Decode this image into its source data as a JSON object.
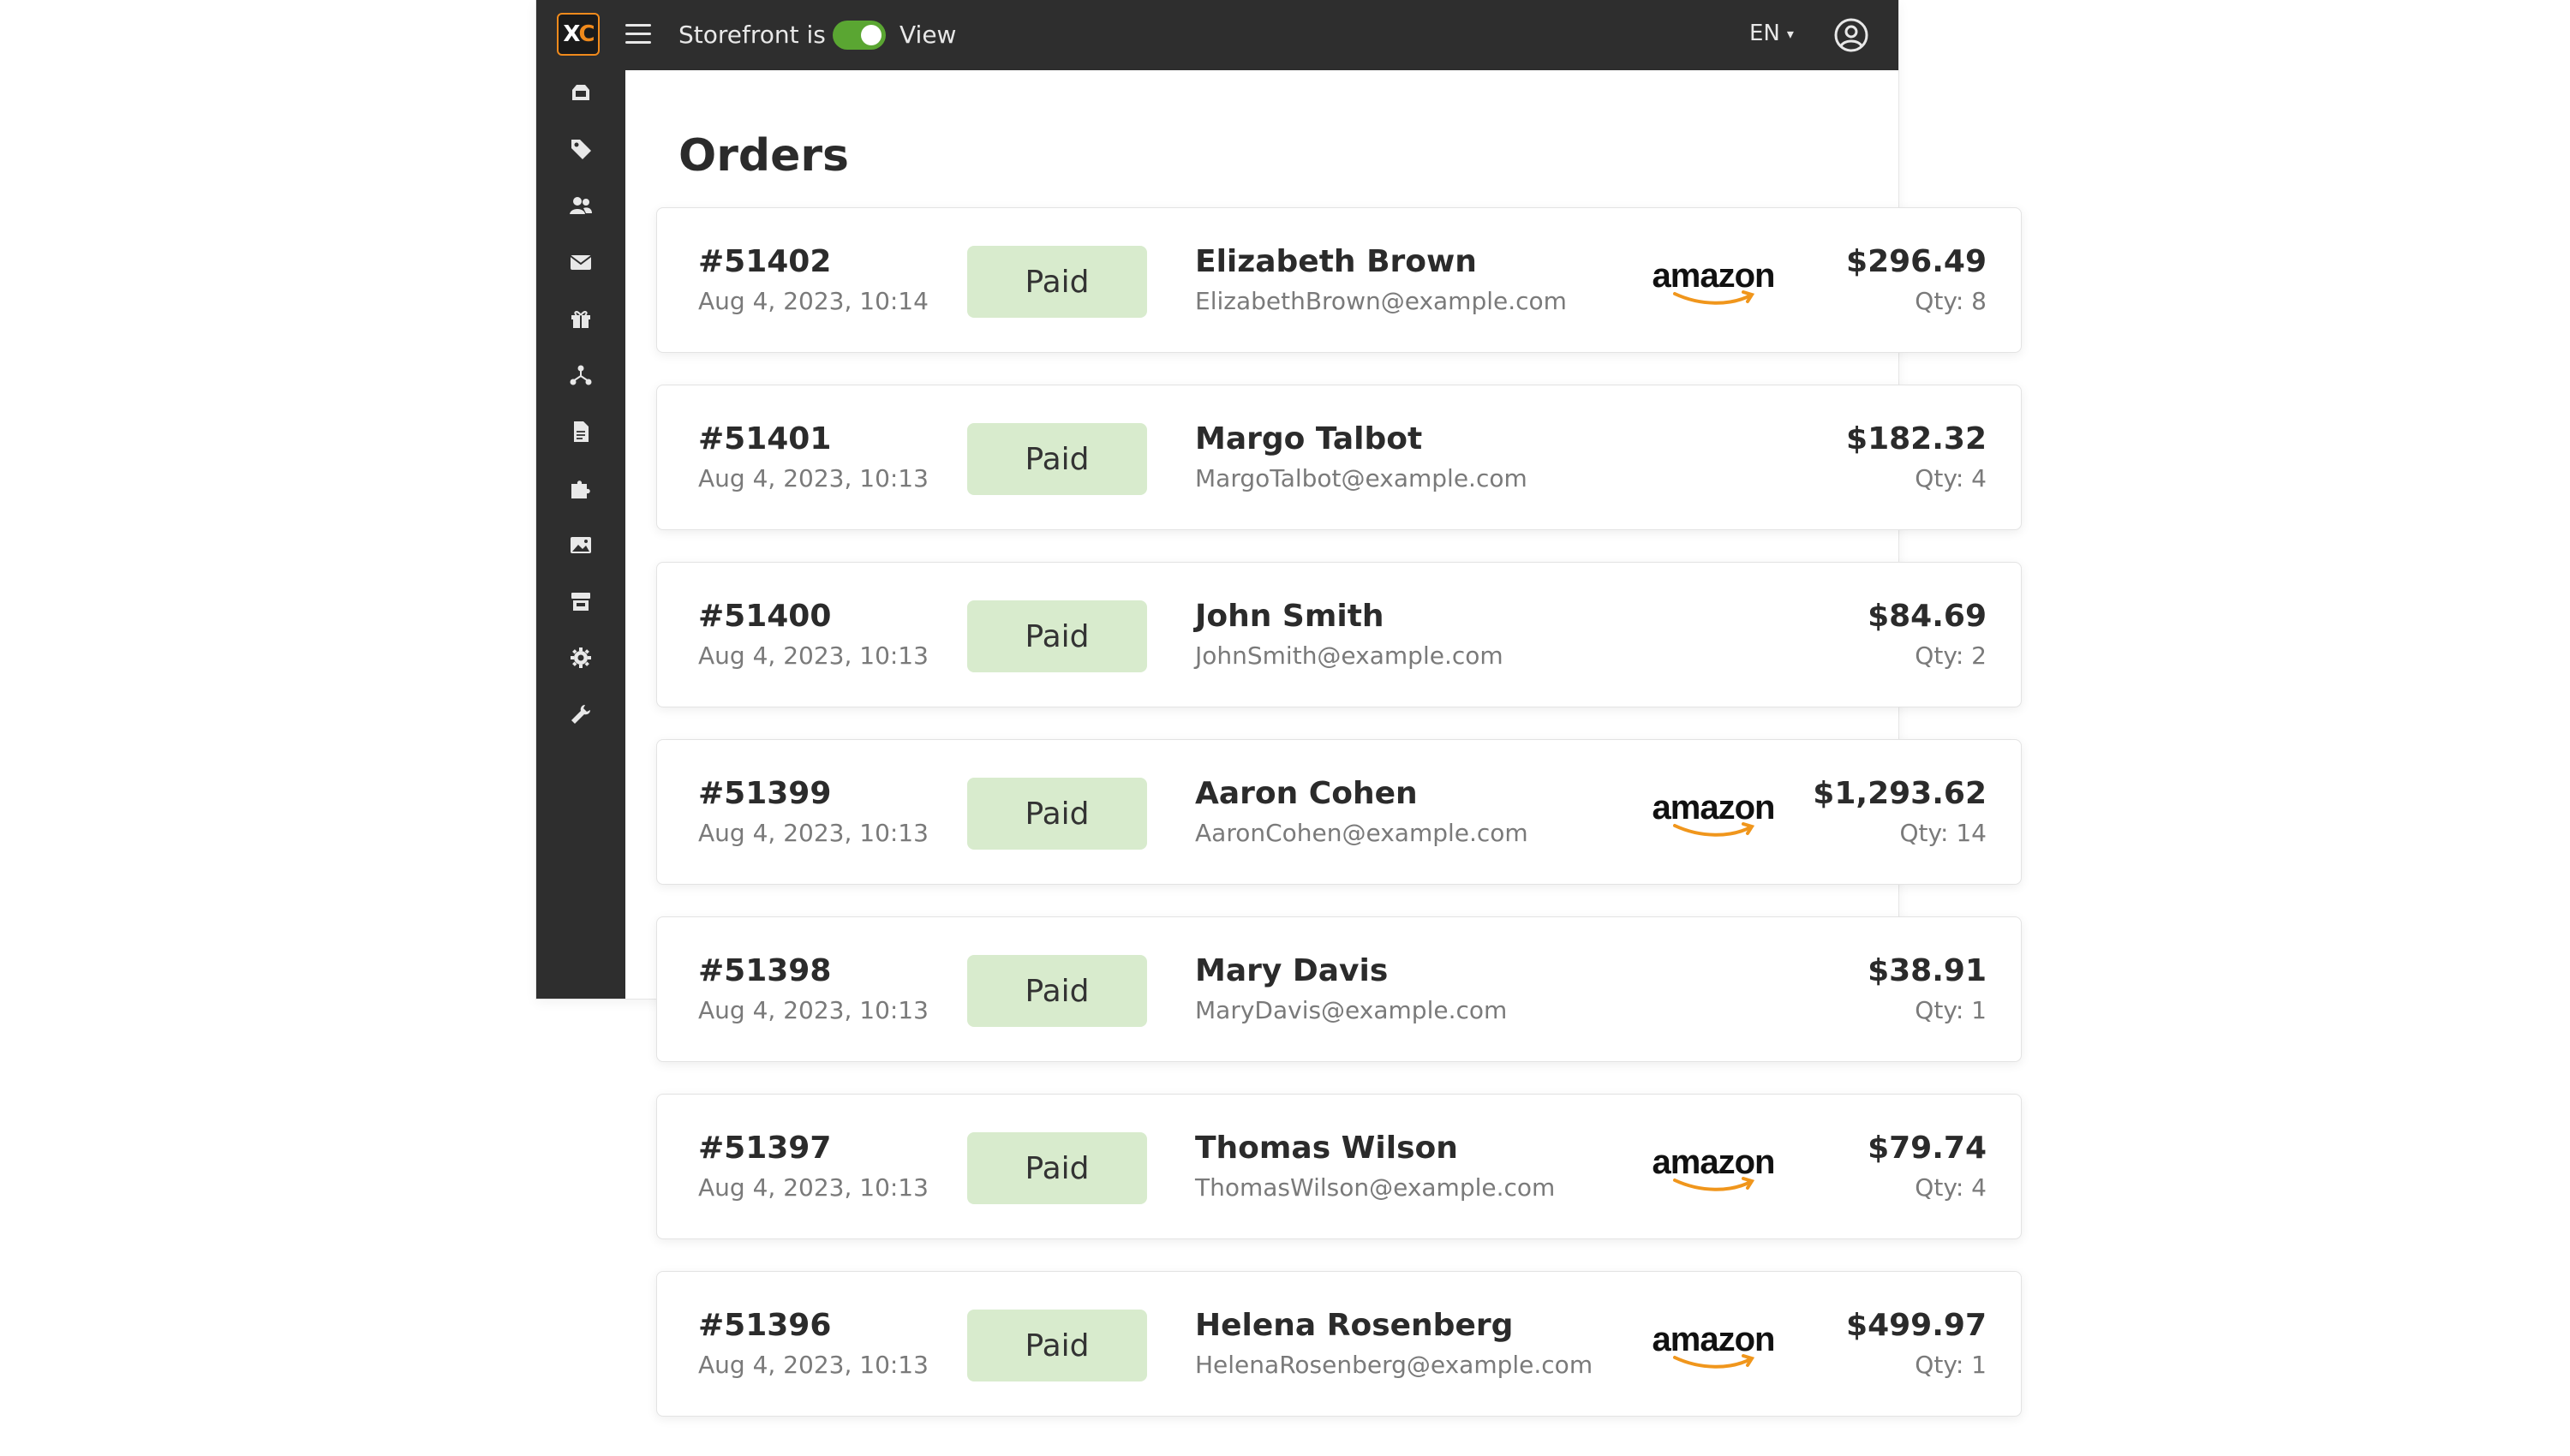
{
  "topbar": {
    "storefront_label": "Storefront is",
    "view_label": "View",
    "language": "EN"
  },
  "page": {
    "title": "Orders"
  },
  "sidebar": {
    "icons": [
      "dashboard-icon",
      "tag-icon",
      "users-icon",
      "mail-icon",
      "gift-icon",
      "network-icon",
      "document-icon",
      "puzzle-icon",
      "image-icon",
      "store-icon",
      "gear-icon",
      "wrench-icon"
    ]
  },
  "orders": [
    {
      "number": "#51402",
      "date": "Aug 4, 2023, 10:14",
      "status": "Paid",
      "name": "Elizabeth Brown",
      "email": "ElizabethBrown@example.com",
      "amount": "$296.49",
      "qty": "Qty: 8",
      "amazon": true
    },
    {
      "number": "#51401",
      "date": "Aug 4, 2023, 10:13",
      "status": "Paid",
      "name": "Margo Talbot",
      "email": "MargoTalbot@example.com",
      "amount": "$182.32",
      "qty": "Qty: 4",
      "amazon": false
    },
    {
      "number": "#51400",
      "date": "Aug 4, 2023, 10:13",
      "status": "Paid",
      "name": "John Smith",
      "email": "JohnSmith@example.com",
      "amount": "$84.69",
      "qty": "Qty: 2",
      "amazon": false
    },
    {
      "number": "#51399",
      "date": "Aug 4, 2023, 10:13",
      "status": "Paid",
      "name": "Aaron Cohen",
      "email": "AaronCohen@example.com",
      "amount": "$1,293.62",
      "qty": "Qty: 14",
      "amazon": true
    },
    {
      "number": "#51398",
      "date": "Aug 4, 2023, 10:13",
      "status": "Paid",
      "name": "Mary Davis",
      "email": "MaryDavis@example.com",
      "amount": "$38.91",
      "qty": "Qty: 1",
      "amazon": false
    },
    {
      "number": "#51397",
      "date": "Aug 4, 2023, 10:13",
      "status": "Paid",
      "name": "Thomas Wilson",
      "email": "ThomasWilson@example.com",
      "amount": "$79.74",
      "qty": "Qty: 4",
      "amazon": true
    },
    {
      "number": "#51396",
      "date": "Aug 4, 2023, 10:13",
      "status": "Paid",
      "name": "Helena Rosenberg",
      "email": "HelenaRosenberg@example.com",
      "amount": "$499.97",
      "qty": "Qty: 1",
      "amazon": true
    }
  ],
  "amazon_logo_text": "amazon",
  "colors": {
    "accent": "#f08a1c",
    "toggle_on": "#5aa632",
    "paid_badge": "#d8ebcd",
    "dark_chrome": "#2e2e2e"
  }
}
